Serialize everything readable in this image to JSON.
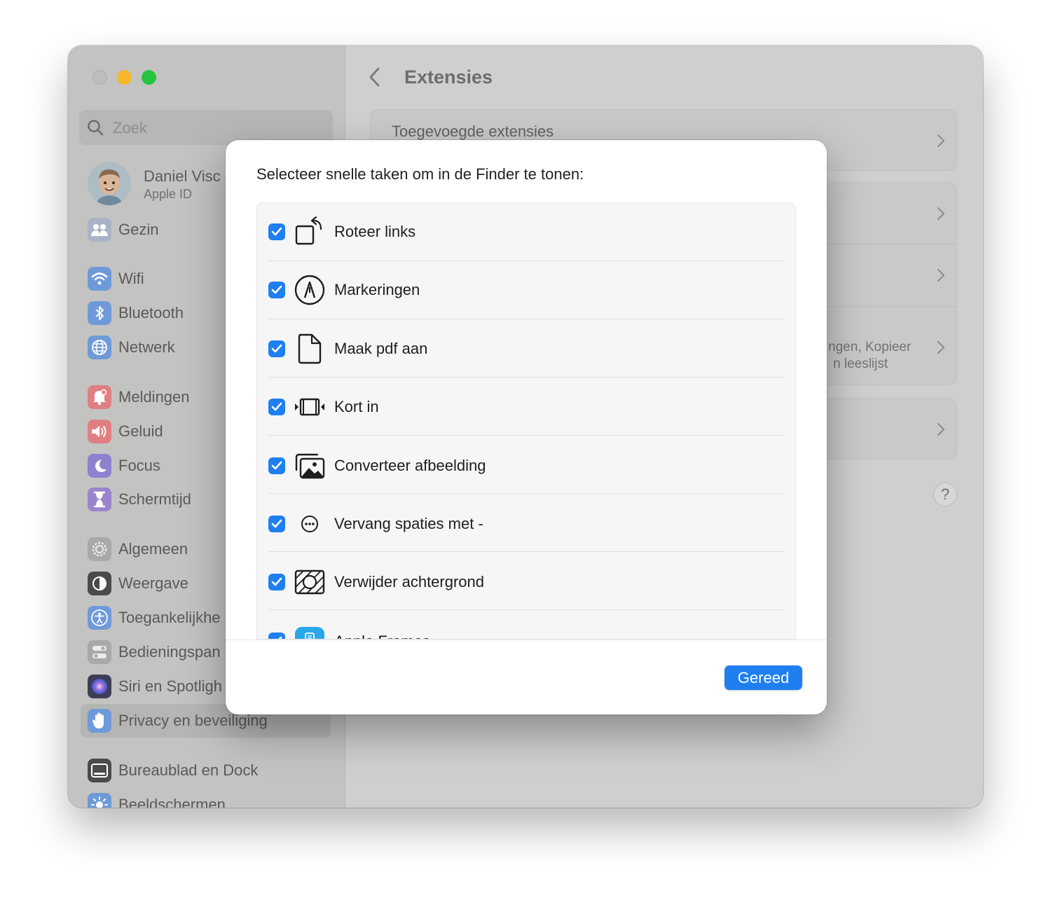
{
  "sidebar": {
    "search": {
      "placeholder": "Zoek"
    },
    "account": {
      "name": "Daniel Visc",
      "subtitle": "Apple ID"
    },
    "items": [
      {
        "label": "Gezin",
        "icon": "family-icon",
        "color": "#9aa7c0"
      },
      {
        "label": "Wifi",
        "icon": "wifi-icon",
        "color": "#5b8fd8"
      },
      {
        "label": "Bluetooth",
        "icon": "bluetooth-icon",
        "color": "#5b8fd8"
      },
      {
        "label": "Netwerk",
        "icon": "globe-icon",
        "color": "#5b8fd8"
      },
      {
        "label": "Meldingen",
        "icon": "bell-icon",
        "color": "#e0676b"
      },
      {
        "label": "Geluid",
        "icon": "speaker-icon",
        "color": "#e0676b"
      },
      {
        "label": "Focus",
        "icon": "moon-icon",
        "color": "#7a6fc8"
      },
      {
        "label": "Schermtijd",
        "icon": "hourglass-icon",
        "color": "#8a70c4"
      },
      {
        "label": "Algemeen",
        "icon": "gear-icon",
        "color": "#a0a09f"
      },
      {
        "label": "Weergave",
        "icon": "appearance-icon",
        "color": "#3a3a3a"
      },
      {
        "label": "Toegankelijkhe",
        "icon": "accessibility-icon",
        "color": "#5b8fd8"
      },
      {
        "label": "Bedieningspan",
        "icon": "control-center-icon",
        "color": "#a0a09f"
      },
      {
        "label": "Siri en Spotligh",
        "icon": "siri-icon",
        "color": "#4a4a6a"
      },
      {
        "label": "Privacy en beveiliging",
        "icon": "hand-icon",
        "color": "#5b8fd8"
      },
      {
        "label": "Bureaublad en Dock",
        "icon": "dock-icon",
        "color": "#3a3a3a"
      },
      {
        "label": "Beeldschermen",
        "icon": "sun-icon",
        "color": "#5b8fd8"
      }
    ]
  },
  "main": {
    "title": "Extensies",
    "panel_label": "Toegevoegde extensies",
    "partial_text_1": "ngen, Kopieer",
    "partial_text_2": "n leeslijst",
    "help": "?"
  },
  "sheet": {
    "title": "Selecteer snelle taken om in de Finder te tonen:",
    "tasks": [
      {
        "label": "Roteer links",
        "icon": "rotate-left-icon",
        "checked": true
      },
      {
        "label": "Markeringen",
        "icon": "markup-icon",
        "checked": true
      },
      {
        "label": "Maak pdf aan",
        "icon": "document-icon",
        "checked": true
      },
      {
        "label": "Kort in",
        "icon": "trim-icon",
        "checked": true
      },
      {
        "label": "Converteer afbeelding",
        "icon": "photos-icon",
        "checked": true
      },
      {
        "label": "Vervang spaties met -",
        "icon": "ellipsis-circle-icon",
        "checked": true
      },
      {
        "label": "Verwijder achtergrond",
        "icon": "remove-background-icon",
        "checked": true
      },
      {
        "label": "Apple Frames",
        "icon": "frames-app-icon",
        "checked": true
      }
    ],
    "done_label": "Gereed",
    "accent": "#1f7ff0"
  }
}
